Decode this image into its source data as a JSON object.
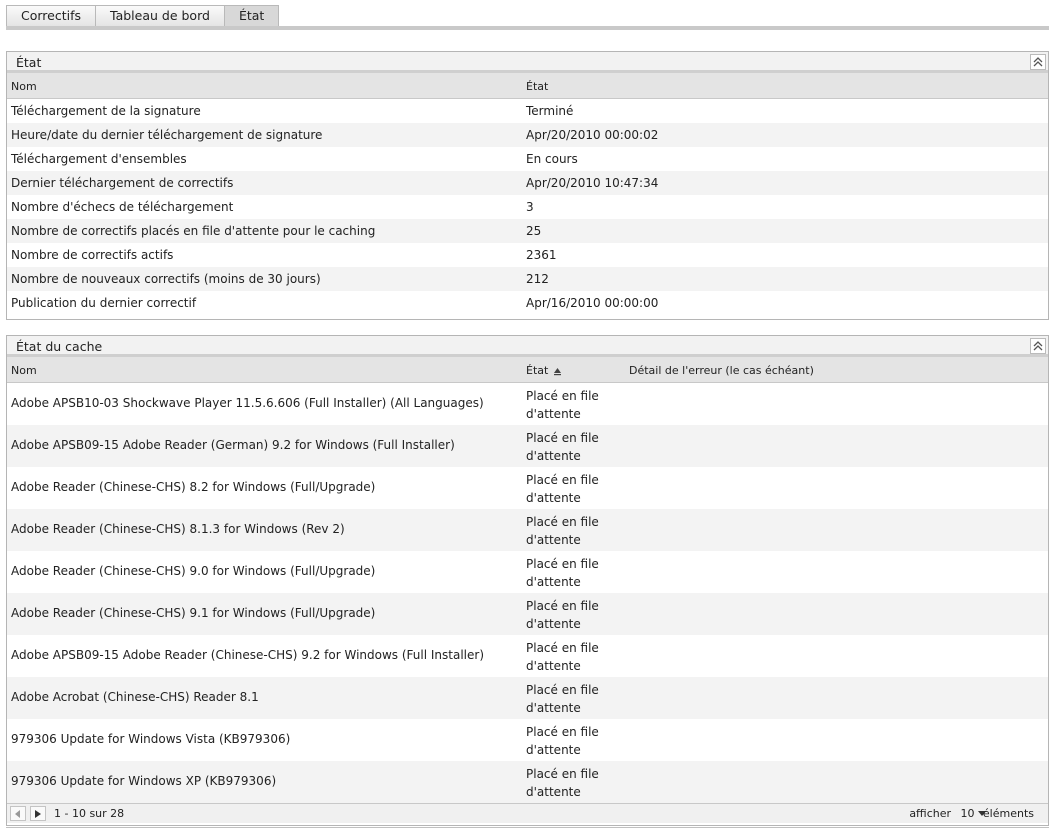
{
  "tabs": [
    {
      "label": "Correctifs"
    },
    {
      "label": "Tableau de bord"
    },
    {
      "label": "État"
    }
  ],
  "status_panel": {
    "title": "État",
    "columns": [
      "Nom",
      "État"
    ],
    "rows": [
      {
        "name": "Téléchargement de la signature",
        "value": "Terminé"
      },
      {
        "name": "Heure/date du dernier téléchargement de signature",
        "value": "Apr/20/2010 00:00:02"
      },
      {
        "name": "Téléchargement d'ensembles",
        "value": "En cours"
      },
      {
        "name": "Dernier téléchargement de correctifs",
        "value": "Apr/20/2010 10:47:34"
      },
      {
        "name": "Nombre d'échecs de téléchargement",
        "value": "3"
      },
      {
        "name": "Nombre de correctifs placés en file d'attente pour le caching",
        "value": "25"
      },
      {
        "name": "Nombre de correctifs actifs",
        "value": "2361"
      },
      {
        "name": "Nombre de nouveaux correctifs (moins de 30 jours)",
        "value": "212"
      },
      {
        "name": "Publication du dernier correctif",
        "value": "Apr/16/2010 00:00:00"
      }
    ]
  },
  "cache_panel": {
    "title": "État du cache",
    "columns": [
      "Nom",
      "État",
      "Détail de l'erreur (le cas échéant)"
    ],
    "rows": [
      {
        "name": "Adobe APSB10-03 Shockwave Player 11.5.6.606 (Full Installer) (All Languages)",
        "status": "Placé en file d'attente"
      },
      {
        "name": "Adobe APSB09-15 Adobe Reader (German) 9.2 for Windows (Full Installer)",
        "status": "Placé en file d'attente"
      },
      {
        "name": "Adobe Reader (Chinese-CHS) 8.2 for Windows (Full/Upgrade)",
        "status": "Placé en file d'attente"
      },
      {
        "name": "Adobe Reader (Chinese-CHS) 8.1.3 for Windows (Rev 2)",
        "status": "Placé en file d'attente"
      },
      {
        "name": "Adobe Reader (Chinese-CHS) 9.0 for Windows (Full/Upgrade)",
        "status": "Placé en file d'attente"
      },
      {
        "name": "Adobe Reader (Chinese-CHS) 9.1 for Windows (Full/Upgrade)",
        "status": "Placé en file d'attente"
      },
      {
        "name": "Adobe APSB09-15 Adobe Reader (Chinese-CHS) 9.2 for Windows (Full Installer)",
        "status": "Placé en file d'attente"
      },
      {
        "name": "Adobe Acrobat (Chinese-CHS) Reader 8.1",
        "status": "Placé en file d'attente"
      },
      {
        "name": "979306 Update for Windows Vista (KB979306)",
        "status": "Placé en file d'attente"
      },
      {
        "name": "979306 Update for Windows XP (KB979306)",
        "status": "Placé en file d'attente"
      }
    ],
    "pager": {
      "range": "1 - 10 sur 28",
      "show_label": "afficher",
      "page_size": "10",
      "items_label": "éléments"
    }
  }
}
